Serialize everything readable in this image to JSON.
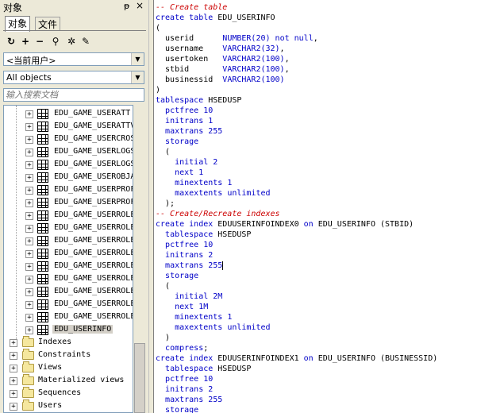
{
  "panel": {
    "title": "对象",
    "pin": "ᵽ",
    "close": "×",
    "tabs": [
      {
        "label": "对象"
      },
      {
        "label": "文件"
      }
    ]
  },
  "toolbar_icons": [
    "refresh-icon",
    "add-icon",
    "remove-icon",
    "find-icon",
    "filter-icon",
    "properties-icon"
  ],
  "user_combo": {
    "value": "<当前用户>"
  },
  "filter_combo": {
    "value": "All objects"
  },
  "search": {
    "placeholder": "输入搜索文档"
  },
  "tree": {
    "tables": [
      "EDU_GAME_USERATT",
      "EDU_GAME_USERATTV",
      "EDU_GAME_USERCROS",
      "EDU_GAME_USERLOGS",
      "EDU_GAME_USERLOGS",
      "EDU_GAME_USEROBJA",
      "EDU_GAME_USERPROF",
      "EDU_GAME_USERPROF",
      "EDU_GAME_USERROLE",
      "EDU_GAME_USERROLE",
      "EDU_GAME_USERROLE",
      "EDU_GAME_USERROLE",
      "EDU_GAME_USERROLE",
      "EDU_GAME_USERROLE",
      "EDU_GAME_USERROLE",
      "EDU_GAME_USERROLE",
      "EDU_GAME_USERROLE"
    ],
    "selected": "EDU_USERINFO",
    "folders": [
      "Indexes",
      "Constraints",
      "Views",
      "Materialized views",
      "Sequences",
      "Users"
    ]
  },
  "editor": {
    "lines": [
      "-- Create table",
      "create table EDU_USERINFO",
      "(",
      "  userid      NUMBER(20) not null,",
      "  username    VARCHAR2(32),",
      "  usertoken   VARCHAR2(100),",
      "  stbid       VARCHAR2(100),",
      "  businessid  VARCHAR2(100)",
      ")",
      "tablespace HSEDUSP",
      "  pctfree 10",
      "  initrans 1",
      "  maxtrans 255",
      "  storage",
      "  (",
      "    initial 2",
      "    next 1",
      "    minextents 1",
      "    maxextents unlimited",
      "  );",
      "-- Create/Recreate indexes",
      "create index EDUUSERINFOINDEX0 on EDU_USERINFO (STBID)",
      "  tablespace HSEDUSP",
      "  pctfree 10",
      "  initrans 2",
      "  maxtrans 255",
      "  storage",
      "  (",
      "    initial 2M",
      "    next 1M",
      "    minextents 1",
      "    maxextents unlimited",
      "  )",
      "  compress;",
      "create index EDUUSERINFOINDEX1 on EDU_USERINFO (BUSINESSID)",
      "  tablespace HSEDUSP",
      "  pctfree 10",
      "  initrans 2",
      "  maxtrans 255",
      "  storage"
    ]
  }
}
